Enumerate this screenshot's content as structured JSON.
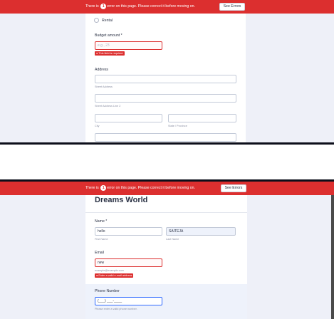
{
  "error_bar": {
    "prefix": "There is",
    "count": "1",
    "suffix": "error on this page. Please correct it before moving on.",
    "button_label": "See Errors"
  },
  "form1": {
    "radio_option": "Rental",
    "budget_label": "Budget amount *",
    "budget_placeholder": "e.g., 23",
    "budget_error": "This field is required.",
    "address_label": "Address",
    "street_address": "Street Address",
    "street_address_2": "Street Address Line 2",
    "city": "City",
    "state": "State / Province"
  },
  "form2": {
    "title": "Dreams World",
    "name_label": "Name *",
    "first_name_value": "hello",
    "last_name_value": "SAITEJA",
    "first_name_sub": "First Name",
    "last_name_sub": "Last Name",
    "email_label": "Email",
    "email_value": "new",
    "email_sub": "example@example.com",
    "email_error": "Enter a valid e-mail address",
    "phone_label": "Phone Number",
    "phone_value": "(___) ___-____",
    "phone_sub": "Please enter a valid phone number."
  }
}
